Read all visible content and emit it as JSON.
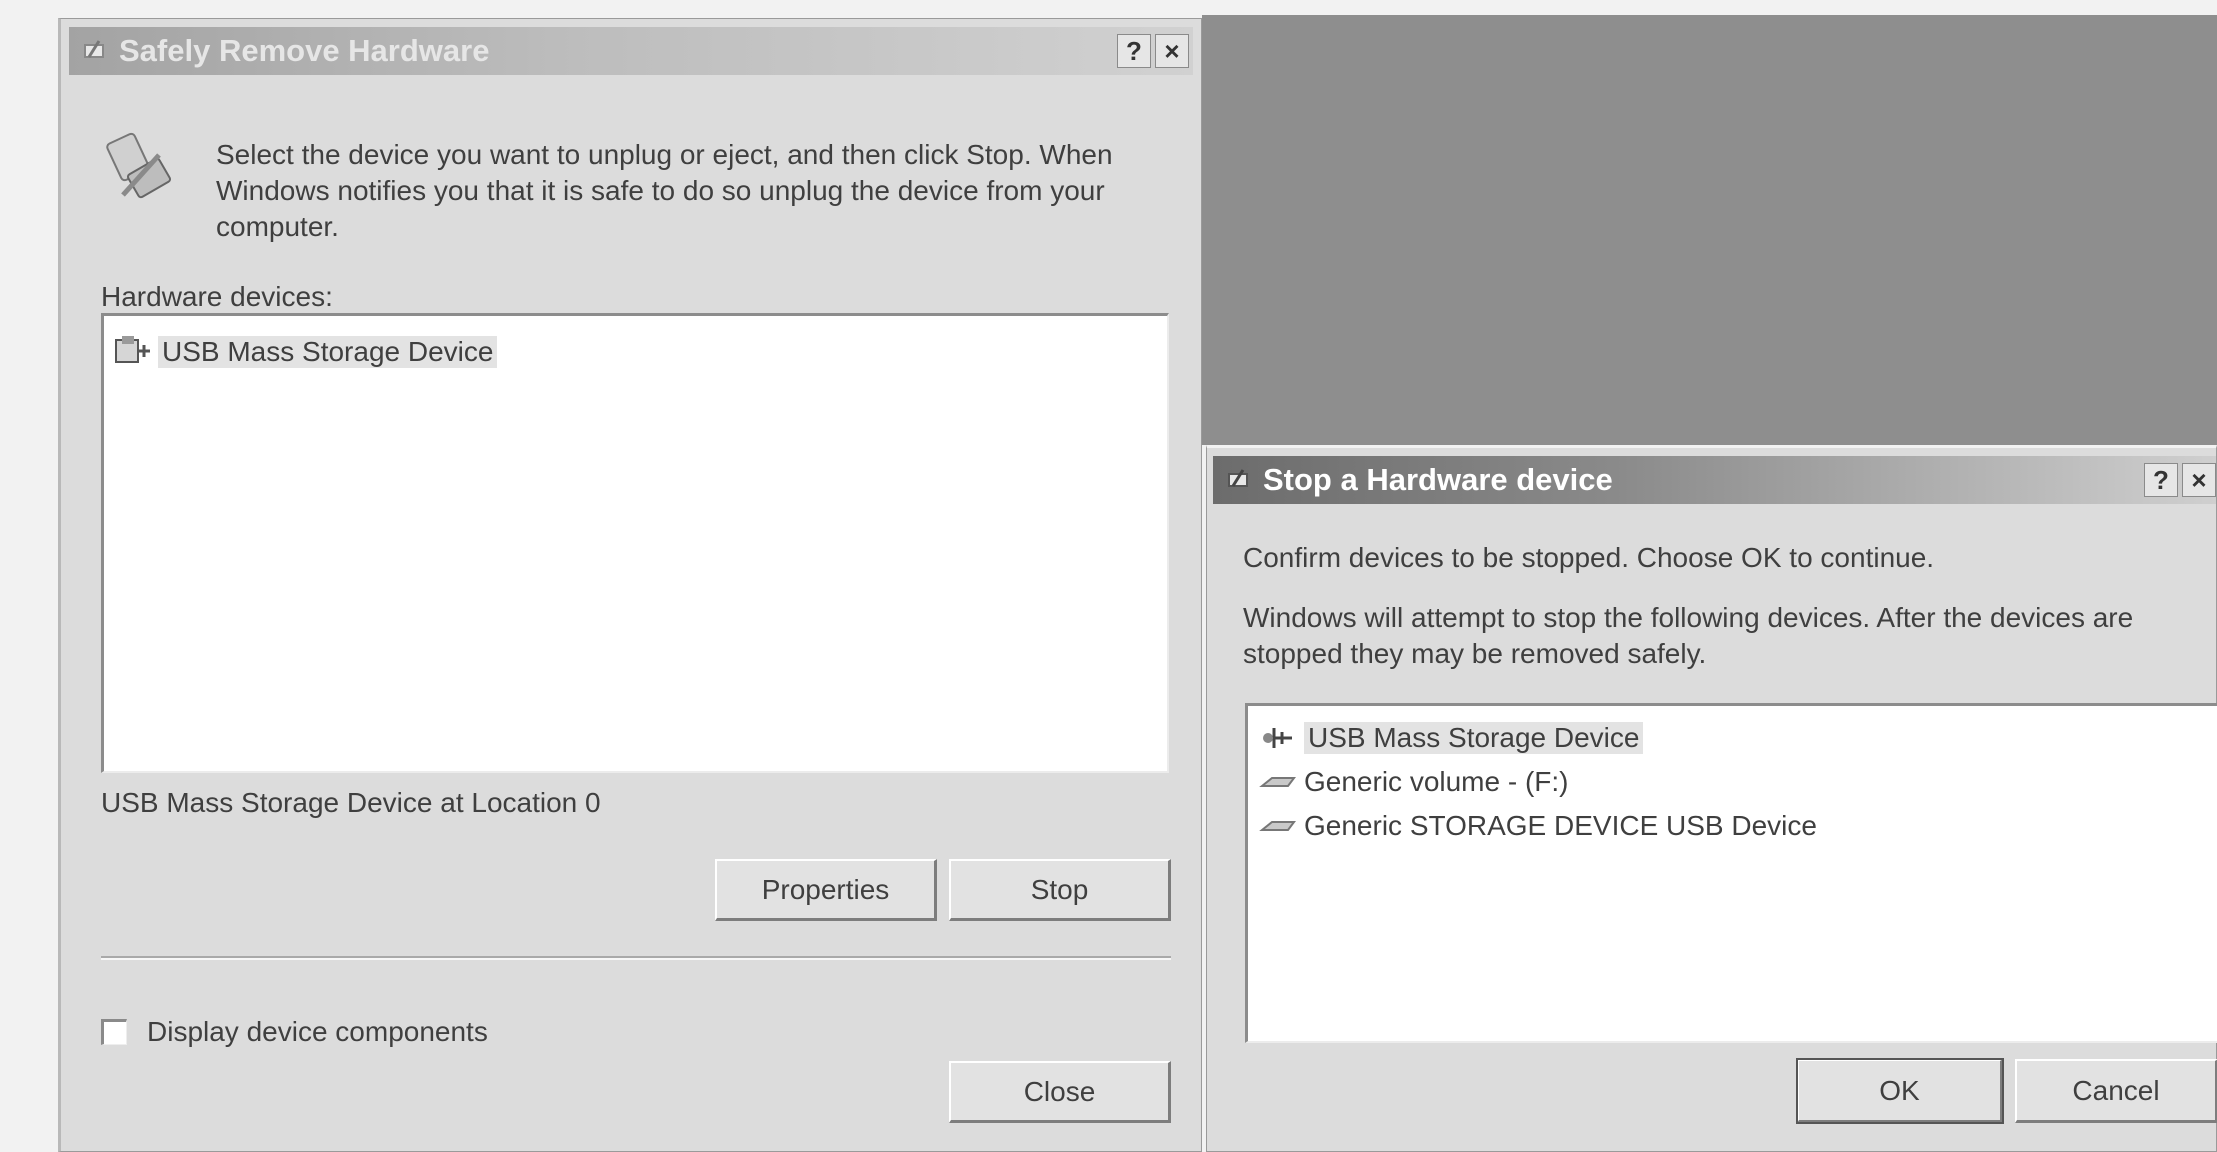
{
  "window1": {
    "title": "Safely Remove Hardware",
    "help_btn": "?",
    "close_btn": "×",
    "instructions": "Select the device you want to unplug or eject, and then click Stop. When Windows notifies you that it is safe to do so unplug the device from your computer.",
    "list_label": "Hardware devices:",
    "devices": [
      {
        "label": "USB Mass Storage Device",
        "icon": "usb-device-icon",
        "selected": true
      }
    ],
    "status_text": "USB Mass Storage Device at Location 0",
    "properties_label": "Properties",
    "stop_label": "Stop",
    "checkbox_label": "Display device components",
    "checkbox_checked": false,
    "close_label": "Close"
  },
  "window2": {
    "title": "Stop a Hardware device",
    "help_btn": "?",
    "close_btn": "×",
    "confirm_text": "Confirm devices to be stopped. Choose OK to continue.",
    "info_text": "Windows will attempt to stop the following devices. After the devices are stopped they may be removed safely.",
    "devices": [
      {
        "label": "USB Mass Storage Device",
        "icon": "usb-device-icon"
      },
      {
        "label": "Generic volume - (F:)",
        "icon": "drive-icon"
      },
      {
        "label": "Generic STORAGE DEVICE USB Device",
        "icon": "drive-icon"
      }
    ],
    "ok_label": "OK",
    "cancel_label": "Cancel"
  }
}
